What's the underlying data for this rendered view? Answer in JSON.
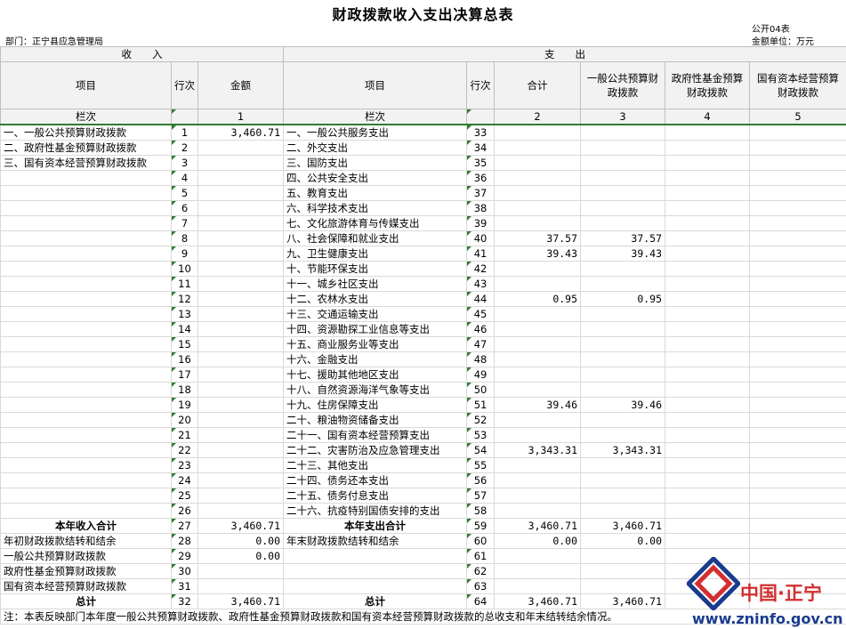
{
  "title": "财政拨款收入支出决算总表",
  "form_no": "公开04表",
  "unit": "金额单位：万元",
  "dept": "部门：正宁县应急管理局",
  "header": {
    "income": "收　　入",
    "expense": "支　　出",
    "col_item": "项目",
    "col_line": "行次",
    "col_amount": "金额",
    "col_total": "合计",
    "col_general": "一般公共预算财政拨款",
    "col_gov_fund": "政府性基金预算财政拨款",
    "col_state_capital": "国有资本经营预算财政拨款",
    "lanci": "栏次",
    "n1": "1",
    "n2": "2",
    "n3": "3",
    "n4": "4",
    "n5": "5"
  },
  "rows": [
    {
      "in_item": "一、一般公共预算财政拨款",
      "in_line": "1",
      "in_amt": "3,460.71",
      "ex_item": "一、一般公共服务支出",
      "ex_line": "33",
      "total": "",
      "general": "",
      "gov": "",
      "sc": ""
    },
    {
      "in_item": "二、政府性基金预算财政拨款",
      "in_line": "2",
      "in_amt": "",
      "ex_item": "二、外交支出",
      "ex_line": "34",
      "total": "",
      "general": "",
      "gov": "",
      "sc": ""
    },
    {
      "in_item": "三、国有资本经营预算财政拨款",
      "in_line": "3",
      "in_amt": "",
      "ex_item": "三、国防支出",
      "ex_line": "35",
      "total": "",
      "general": "",
      "gov": "",
      "sc": ""
    },
    {
      "in_item": "",
      "in_line": "4",
      "in_amt": "",
      "ex_item": "四、公共安全支出",
      "ex_line": "36",
      "total": "",
      "general": "",
      "gov": "",
      "sc": ""
    },
    {
      "in_item": "",
      "in_line": "5",
      "in_amt": "",
      "ex_item": "五、教育支出",
      "ex_line": "37",
      "total": "",
      "general": "",
      "gov": "",
      "sc": ""
    },
    {
      "in_item": "",
      "in_line": "6",
      "in_amt": "",
      "ex_item": "六、科学技术支出",
      "ex_line": "38",
      "total": "",
      "general": "",
      "gov": "",
      "sc": ""
    },
    {
      "in_item": "",
      "in_line": "7",
      "in_amt": "",
      "ex_item": "七、文化旅游体育与传媒支出",
      "ex_line": "39",
      "total": "",
      "general": "",
      "gov": "",
      "sc": ""
    },
    {
      "in_item": "",
      "in_line": "8",
      "in_amt": "",
      "ex_item": "八、社会保障和就业支出",
      "ex_line": "40",
      "total": "37.57",
      "general": "37.57",
      "gov": "",
      "sc": ""
    },
    {
      "in_item": "",
      "in_line": "9",
      "in_amt": "",
      "ex_item": "九、卫生健康支出",
      "ex_line": "41",
      "total": "39.43",
      "general": "39.43",
      "gov": "",
      "sc": ""
    },
    {
      "in_item": "",
      "in_line": "10",
      "in_amt": "",
      "ex_item": "十、节能环保支出",
      "ex_line": "42",
      "total": "",
      "general": "",
      "gov": "",
      "sc": ""
    },
    {
      "in_item": "",
      "in_line": "11",
      "in_amt": "",
      "ex_item": "十一、城乡社区支出",
      "ex_line": "43",
      "total": "",
      "general": "",
      "gov": "",
      "sc": ""
    },
    {
      "in_item": "",
      "in_line": "12",
      "in_amt": "",
      "ex_item": "十二、农林水支出",
      "ex_line": "44",
      "total": "0.95",
      "general": "0.95",
      "gov": "",
      "sc": ""
    },
    {
      "in_item": "",
      "in_line": "13",
      "in_amt": "",
      "ex_item": "十三、交通运输支出",
      "ex_line": "45",
      "total": "",
      "general": "",
      "gov": "",
      "sc": ""
    },
    {
      "in_item": "",
      "in_line": "14",
      "in_amt": "",
      "ex_item": "十四、资源勘探工业信息等支出",
      "ex_line": "46",
      "total": "",
      "general": "",
      "gov": "",
      "sc": ""
    },
    {
      "in_item": "",
      "in_line": "15",
      "in_amt": "",
      "ex_item": "十五、商业服务业等支出",
      "ex_line": "47",
      "total": "",
      "general": "",
      "gov": "",
      "sc": ""
    },
    {
      "in_item": "",
      "in_line": "16",
      "in_amt": "",
      "ex_item": "十六、金融支出",
      "ex_line": "48",
      "total": "",
      "general": "",
      "gov": "",
      "sc": ""
    },
    {
      "in_item": "",
      "in_line": "17",
      "in_amt": "",
      "ex_item": "十七、援助其他地区支出",
      "ex_line": "49",
      "total": "",
      "general": "",
      "gov": "",
      "sc": ""
    },
    {
      "in_item": "",
      "in_line": "18",
      "in_amt": "",
      "ex_item": "十八、自然资源海洋气象等支出",
      "ex_line": "50",
      "total": "",
      "general": "",
      "gov": "",
      "sc": ""
    },
    {
      "in_item": "",
      "in_line": "19",
      "in_amt": "",
      "ex_item": "十九、住房保障支出",
      "ex_line": "51",
      "total": "39.46",
      "general": "39.46",
      "gov": "",
      "sc": ""
    },
    {
      "in_item": "",
      "in_line": "20",
      "in_amt": "",
      "ex_item": "二十、粮油物资储备支出",
      "ex_line": "52",
      "total": "",
      "general": "",
      "gov": "",
      "sc": ""
    },
    {
      "in_item": "",
      "in_line": "21",
      "in_amt": "",
      "ex_item": "二十一、国有资本经营预算支出",
      "ex_line": "53",
      "total": "",
      "general": "",
      "gov": "",
      "sc": ""
    },
    {
      "in_item": "",
      "in_line": "22",
      "in_amt": "",
      "ex_item": "二十二、灾害防治及应急管理支出",
      "ex_line": "54",
      "total": "3,343.31",
      "general": "3,343.31",
      "gov": "",
      "sc": ""
    },
    {
      "in_item": "",
      "in_line": "23",
      "in_amt": "",
      "ex_item": "二十三、其他支出",
      "ex_line": "55",
      "total": "",
      "general": "",
      "gov": "",
      "sc": ""
    },
    {
      "in_item": "",
      "in_line": "24",
      "in_amt": "",
      "ex_item": "二十四、债务还本支出",
      "ex_line": "56",
      "total": "",
      "general": "",
      "gov": "",
      "sc": ""
    },
    {
      "in_item": "",
      "in_line": "25",
      "in_amt": "",
      "ex_item": "二十五、债务付息支出",
      "ex_line": "57",
      "total": "",
      "general": "",
      "gov": "",
      "sc": ""
    },
    {
      "in_item": "",
      "in_line": "26",
      "in_amt": "",
      "ex_item": "二十六、抗疫特别国债安排的支出",
      "ex_line": "58",
      "total": "",
      "general": "",
      "gov": "",
      "sc": ""
    }
  ],
  "summary": [
    {
      "in_item": "本年收入合计",
      "in_line": "27",
      "in_amt": "3,460.71",
      "ex_item": "本年支出合计",
      "ex_line": "59",
      "total": "3,460.71",
      "general": "3,460.71",
      "in_bold": true,
      "ex_bold": true
    },
    {
      "in_item": "年初财政拨款结转和结余",
      "in_line": "28",
      "in_amt": "0.00",
      "ex_item": "年末财政拨款结转和结余",
      "ex_line": "60",
      "total": "0.00",
      "general": "0.00"
    },
    {
      "in_item": "一般公共预算财政拨款",
      "in_line": "29",
      "in_amt": "0.00",
      "ex_item": "",
      "ex_line": "61",
      "total": "",
      "general": "",
      "indent": true
    },
    {
      "in_item": "政府性基金预算财政拨款",
      "in_line": "30",
      "in_amt": "",
      "ex_item": "",
      "ex_line": "62",
      "total": "",
      "general": "",
      "indent": true
    },
    {
      "in_item": "国有资本经营预算财政拨款",
      "in_line": "31",
      "in_amt": "",
      "ex_item": "",
      "ex_line": "63",
      "total": "",
      "general": "",
      "indent": true
    },
    {
      "in_item": "总计",
      "in_line": "32",
      "in_amt": "3,460.71",
      "ex_item": "总计",
      "ex_line": "64",
      "total": "3,460.71",
      "general": "3,460.71",
      "in_bold": true,
      "ex_bold": true
    }
  ],
  "note": "注：本表反映部门本年度一般公共预算财政拨款、政府性基金预算财政拨款和国有资本经营预算财政拨款的总收支和年末结转结余情况。",
  "logo": {
    "cn": "中国·正宁",
    "url": "www.zninfo.gov.cn"
  }
}
